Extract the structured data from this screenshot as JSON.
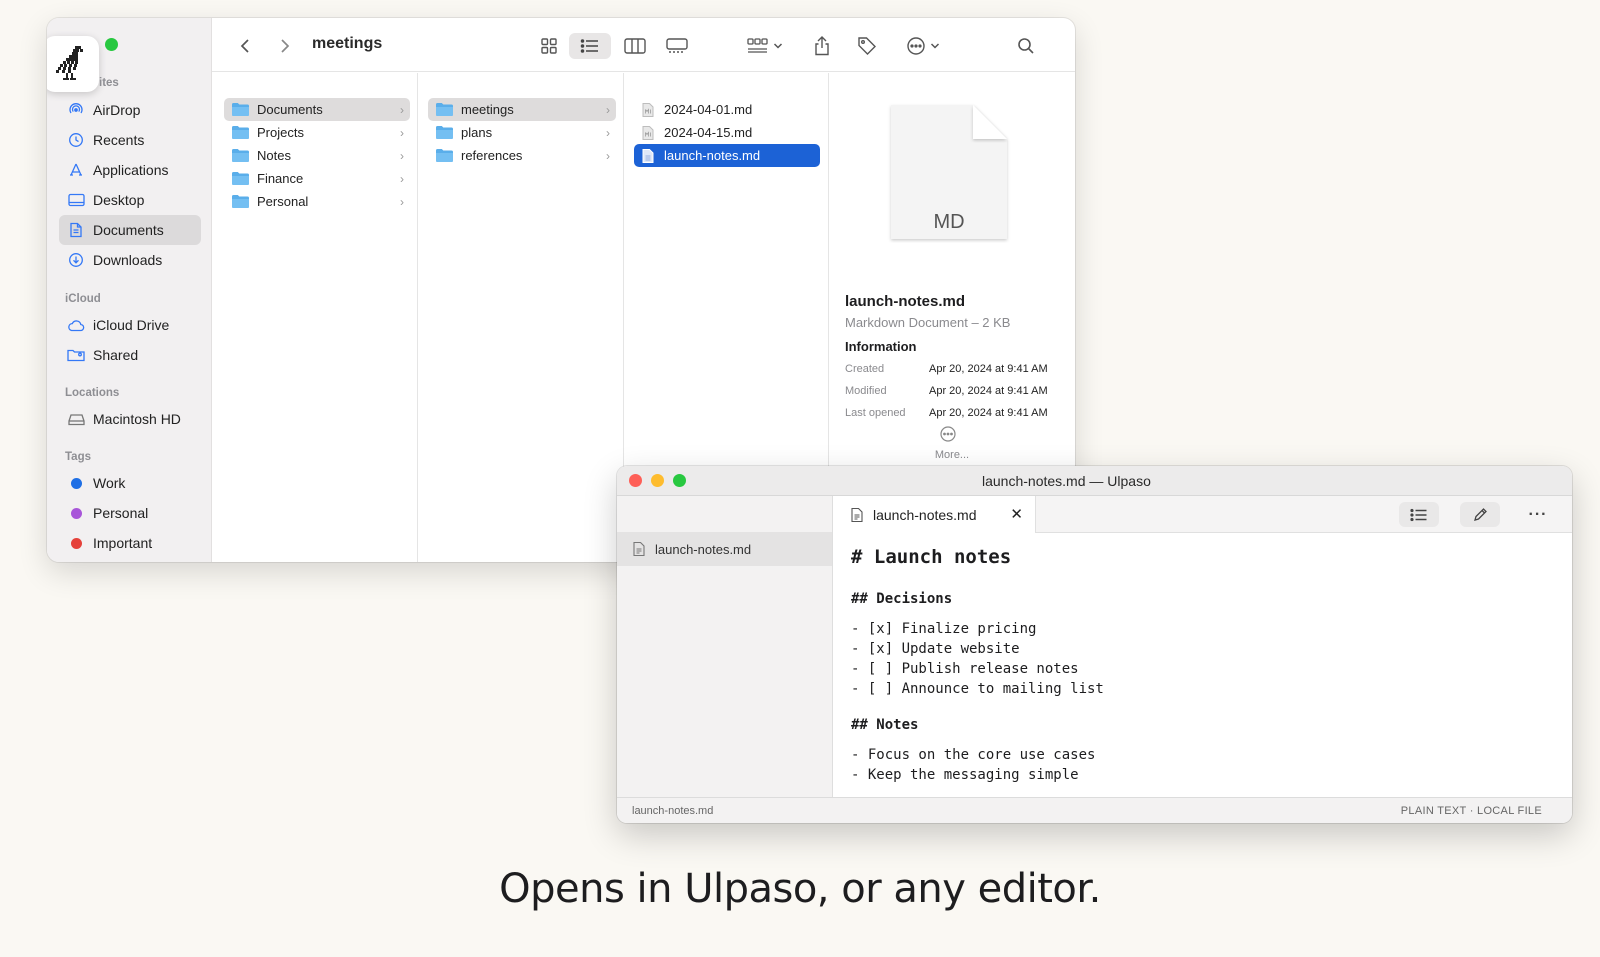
{
  "finder": {
    "path_title": "meetings",
    "sidebar": {
      "favorites_label": "ites",
      "favorites": [
        {
          "label": "AirDrop",
          "icon": "airdrop-icon"
        },
        {
          "label": "Recents",
          "icon": "clock-icon"
        },
        {
          "label": "Applications",
          "icon": "applications-icon"
        },
        {
          "label": "Desktop",
          "icon": "desktop-icon"
        },
        {
          "label": "Documents",
          "icon": "document-icon",
          "selected": true
        },
        {
          "label": "Downloads",
          "icon": "download-icon"
        }
      ],
      "icloud_label": "iCloud",
      "icloud": [
        {
          "label": "iCloud Drive",
          "icon": "cloud-icon"
        },
        {
          "label": "Shared",
          "icon": "shared-folder-icon"
        }
      ],
      "locations_label": "Locations",
      "locations": [
        {
          "label": "Macintosh HD",
          "icon": "disk-icon"
        }
      ],
      "tags_label": "Tags",
      "tags": [
        {
          "label": "Work",
          "color": "#1f6fe5"
        },
        {
          "label": "Personal",
          "color": "#a855d9"
        },
        {
          "label": "Important",
          "color": "#e5413a"
        }
      ]
    },
    "column1": [
      "Documents",
      "Projects",
      "Notes",
      "Finance",
      "Personal"
    ],
    "column2": [
      "meetings",
      "plans",
      "references"
    ],
    "column3": [
      "2024-04-01.md",
      "2024-04-15.md",
      "launch-notes.md"
    ],
    "preview": {
      "badge": "MD",
      "name": "launch-notes.md",
      "kind": "Markdown Document – 2 KB",
      "info_title": "Information",
      "rows": [
        {
          "k": "Created",
          "v": "Apr 20, 2024 at 9:41 AM"
        },
        {
          "k": "Modified",
          "v": "Apr 20, 2024 at 9:41 AM"
        },
        {
          "k": "Last opened",
          "v": "Apr 20, 2024 at 9:41 AM"
        }
      ],
      "more": "More..."
    }
  },
  "ulpaso": {
    "title": "launch-notes.md — Ulpaso",
    "sidebar_file": "launch-notes.md",
    "tab_label": "launch-notes.md",
    "lines": [
      "# Launch notes",
      "## Decisions",
      "- [x] Finalize pricing",
      "- [x] Update website",
      "- [ ] Publish release notes",
      "- [ ] Announce to mailing list",
      "## Notes",
      "- Focus on the core use cases",
      "- Keep the messaging simple"
    ],
    "status_left": "launch-notes.md",
    "status_right": "PLAIN TEXT  ·  LOCAL FILE"
  },
  "tagline": "Opens in Ulpaso, or any editor.",
  "colors": {
    "accent": "#1c62d6",
    "background": "#faf8f3"
  }
}
